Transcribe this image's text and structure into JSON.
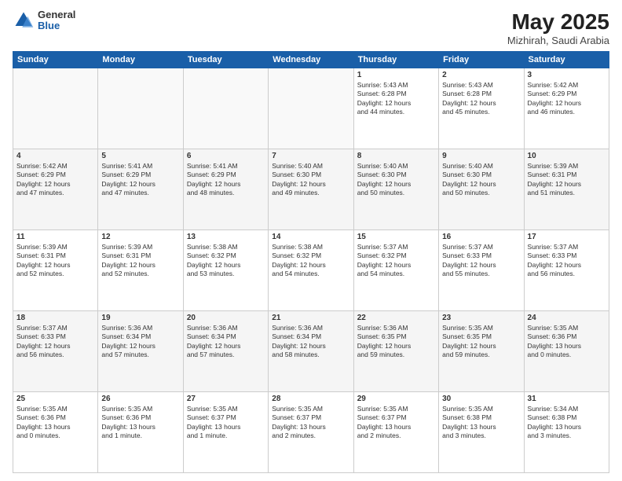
{
  "header": {
    "logo_general": "General",
    "logo_blue": "Blue",
    "title": "May 2025",
    "location": "Mizhirah, Saudi Arabia"
  },
  "days_of_week": [
    "Sunday",
    "Monday",
    "Tuesday",
    "Wednesday",
    "Thursday",
    "Friday",
    "Saturday"
  ],
  "weeks": [
    [
      {
        "day": "",
        "info": ""
      },
      {
        "day": "",
        "info": ""
      },
      {
        "day": "",
        "info": ""
      },
      {
        "day": "",
        "info": ""
      },
      {
        "day": "1",
        "info": "Sunrise: 5:43 AM\nSunset: 6:28 PM\nDaylight: 12 hours\nand 44 minutes."
      },
      {
        "day": "2",
        "info": "Sunrise: 5:43 AM\nSunset: 6:28 PM\nDaylight: 12 hours\nand 45 minutes."
      },
      {
        "day": "3",
        "info": "Sunrise: 5:42 AM\nSunset: 6:29 PM\nDaylight: 12 hours\nand 46 minutes."
      }
    ],
    [
      {
        "day": "4",
        "info": "Sunrise: 5:42 AM\nSunset: 6:29 PM\nDaylight: 12 hours\nand 47 minutes."
      },
      {
        "day": "5",
        "info": "Sunrise: 5:41 AM\nSunset: 6:29 PM\nDaylight: 12 hours\nand 47 minutes."
      },
      {
        "day": "6",
        "info": "Sunrise: 5:41 AM\nSunset: 6:29 PM\nDaylight: 12 hours\nand 48 minutes."
      },
      {
        "day": "7",
        "info": "Sunrise: 5:40 AM\nSunset: 6:30 PM\nDaylight: 12 hours\nand 49 minutes."
      },
      {
        "day": "8",
        "info": "Sunrise: 5:40 AM\nSunset: 6:30 PM\nDaylight: 12 hours\nand 50 minutes."
      },
      {
        "day": "9",
        "info": "Sunrise: 5:40 AM\nSunset: 6:30 PM\nDaylight: 12 hours\nand 50 minutes."
      },
      {
        "day": "10",
        "info": "Sunrise: 5:39 AM\nSunset: 6:31 PM\nDaylight: 12 hours\nand 51 minutes."
      }
    ],
    [
      {
        "day": "11",
        "info": "Sunrise: 5:39 AM\nSunset: 6:31 PM\nDaylight: 12 hours\nand 52 minutes."
      },
      {
        "day": "12",
        "info": "Sunrise: 5:39 AM\nSunset: 6:31 PM\nDaylight: 12 hours\nand 52 minutes."
      },
      {
        "day": "13",
        "info": "Sunrise: 5:38 AM\nSunset: 6:32 PM\nDaylight: 12 hours\nand 53 minutes."
      },
      {
        "day": "14",
        "info": "Sunrise: 5:38 AM\nSunset: 6:32 PM\nDaylight: 12 hours\nand 54 minutes."
      },
      {
        "day": "15",
        "info": "Sunrise: 5:37 AM\nSunset: 6:32 PM\nDaylight: 12 hours\nand 54 minutes."
      },
      {
        "day": "16",
        "info": "Sunrise: 5:37 AM\nSunset: 6:33 PM\nDaylight: 12 hours\nand 55 minutes."
      },
      {
        "day": "17",
        "info": "Sunrise: 5:37 AM\nSunset: 6:33 PM\nDaylight: 12 hours\nand 56 minutes."
      }
    ],
    [
      {
        "day": "18",
        "info": "Sunrise: 5:37 AM\nSunset: 6:33 PM\nDaylight: 12 hours\nand 56 minutes."
      },
      {
        "day": "19",
        "info": "Sunrise: 5:36 AM\nSunset: 6:34 PM\nDaylight: 12 hours\nand 57 minutes."
      },
      {
        "day": "20",
        "info": "Sunrise: 5:36 AM\nSunset: 6:34 PM\nDaylight: 12 hours\nand 57 minutes."
      },
      {
        "day": "21",
        "info": "Sunrise: 5:36 AM\nSunset: 6:34 PM\nDaylight: 12 hours\nand 58 minutes."
      },
      {
        "day": "22",
        "info": "Sunrise: 5:36 AM\nSunset: 6:35 PM\nDaylight: 12 hours\nand 59 minutes."
      },
      {
        "day": "23",
        "info": "Sunrise: 5:35 AM\nSunset: 6:35 PM\nDaylight: 12 hours\nand 59 minutes."
      },
      {
        "day": "24",
        "info": "Sunrise: 5:35 AM\nSunset: 6:36 PM\nDaylight: 13 hours\nand 0 minutes."
      }
    ],
    [
      {
        "day": "25",
        "info": "Sunrise: 5:35 AM\nSunset: 6:36 PM\nDaylight: 13 hours\nand 0 minutes."
      },
      {
        "day": "26",
        "info": "Sunrise: 5:35 AM\nSunset: 6:36 PM\nDaylight: 13 hours\nand 1 minute."
      },
      {
        "day": "27",
        "info": "Sunrise: 5:35 AM\nSunset: 6:37 PM\nDaylight: 13 hours\nand 1 minute."
      },
      {
        "day": "28",
        "info": "Sunrise: 5:35 AM\nSunset: 6:37 PM\nDaylight: 13 hours\nand 2 minutes."
      },
      {
        "day": "29",
        "info": "Sunrise: 5:35 AM\nSunset: 6:37 PM\nDaylight: 13 hours\nand 2 minutes."
      },
      {
        "day": "30",
        "info": "Sunrise: 5:35 AM\nSunset: 6:38 PM\nDaylight: 13 hours\nand 3 minutes."
      },
      {
        "day": "31",
        "info": "Sunrise: 5:34 AM\nSunset: 6:38 PM\nDaylight: 13 hours\nand 3 minutes."
      }
    ]
  ]
}
